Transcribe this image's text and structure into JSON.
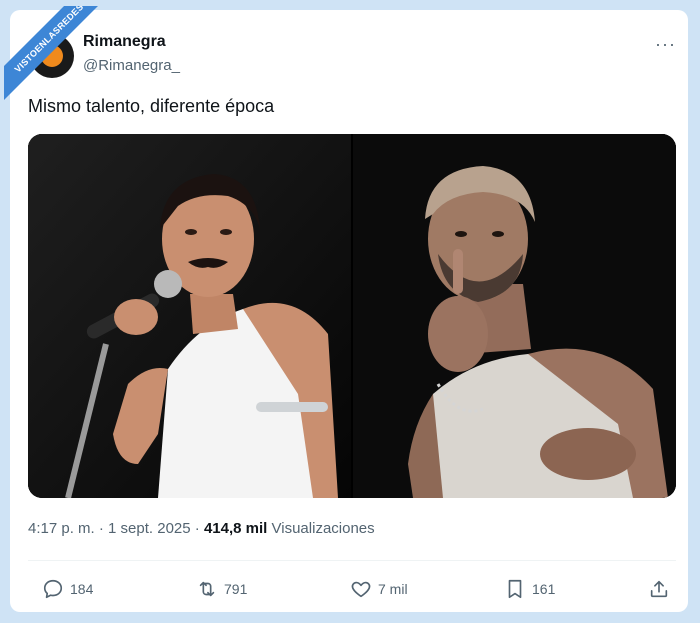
{
  "watermark": {
    "text": "VISTOENLASREDES"
  },
  "author": {
    "name": "Rimanegra",
    "handle": "@Rimanegra_"
  },
  "menu": {
    "icon": "more-horizontal-icon",
    "label": "···"
  },
  "tweet": {
    "text": "Mismo talento, diferente época"
  },
  "meta": {
    "time": "4:17 p. m.",
    "sep1": " · ",
    "date": "1 sept. 2025",
    "sep2": " · ",
    "views_count": "414,8 mil",
    "views_label": " Visualizaciones"
  },
  "actions": {
    "replies": "184",
    "retweets": "791",
    "likes": "7 mil",
    "bookmarks": "161"
  },
  "colors": {
    "accent": "#3d86d6",
    "text": "#0f1419",
    "muted": "#536471"
  }
}
